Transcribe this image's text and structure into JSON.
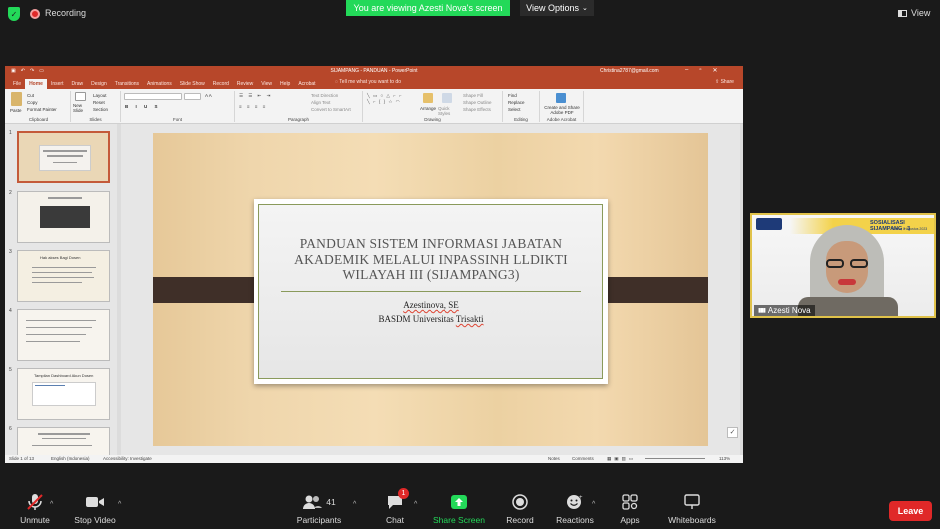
{
  "zoom_top": {
    "recording": "Recording",
    "viewing_banner": "You are viewing Azesti Nova's screen",
    "view_options": "View Options",
    "view": "View"
  },
  "ppt": {
    "window_title": "SIJAMPANG - PANDUAN  -  PowerPoint",
    "user_email": "Christina2787@gmail.com",
    "tabs": [
      "File",
      "Home",
      "Insert",
      "Draw",
      "Design",
      "Transitions",
      "Animations",
      "Slide Show",
      "Record",
      "Review",
      "View",
      "Help",
      "Acrobat"
    ],
    "tell_me": "Tell me what you want to do",
    "share": "Share",
    "ribbon": {
      "paste": "Paste",
      "cut": "Cut",
      "copy": "Copy",
      "format_painter": "Format Painter",
      "new_slide": "New Slide",
      "layout": "Layout",
      "reset": "Reset",
      "section": "Section",
      "text_direction": "Text Direction",
      "align_text": "Align Text",
      "convert_smartart": "Convert to SmartArt",
      "arrange": "Arrange",
      "quick_styles": "Quick Styles",
      "shape_fill": "Shape Fill",
      "shape_outline": "Shape Outline",
      "shape_effects": "Shape Effects",
      "find": "Find",
      "replace": "Replace",
      "select": "Select",
      "create_share_pdf": "Create and Share Adobe PDF",
      "groups": [
        "Clipboard",
        "Slides",
        "Font",
        "Paragraph",
        "Drawing",
        "Editing",
        "Adobe Acrobat"
      ]
    },
    "thumbnails": [
      "1",
      "2",
      "3",
      "4",
      "5",
      "6"
    ],
    "thumb3_title": "Hak akses Bagi Dosen",
    "thumb5_title": "Tampilan Dashboard Akun Dosen",
    "slide": {
      "title": "PANDUAN SISTEM INFORMASI JABATAN AKADEMIK MELALUI INPASSINH LLDIKTI WILAYAH III (SIJAMPANG3)",
      "author": "Azestinova, SE",
      "org_prefix": "BASDM Universitas ",
      "org_squiggle": "Trisakti"
    },
    "status": {
      "slide_count": "Slide 1 of 13",
      "language": "English (Indonesia)",
      "accessibility": "Accessibility: Investigate",
      "notes": "Notes",
      "comments": "Comments",
      "zoom": "113%"
    }
  },
  "video": {
    "participant_name": "Azesti Nova",
    "banner_text": "SOSIALISASI SIJAMPANG - 3",
    "banner_sub": "Sabtu, 8 Agustus 2023"
  },
  "bottombar": {
    "unmute": "Unmute",
    "stop_video": "Stop Video",
    "participants": "Participants",
    "participants_count": "41",
    "chat": "Chat",
    "chat_badge": "1",
    "share_screen": "Share Screen",
    "record": "Record",
    "reactions": "Reactions",
    "apps": "Apps",
    "whiteboards": "Whiteboards",
    "leave": "Leave"
  },
  "colors": {
    "zoom_green": "#23d959",
    "ppt_accent": "#b7472a",
    "leave_red": "#e02828",
    "video_border": "#e0c24a"
  }
}
